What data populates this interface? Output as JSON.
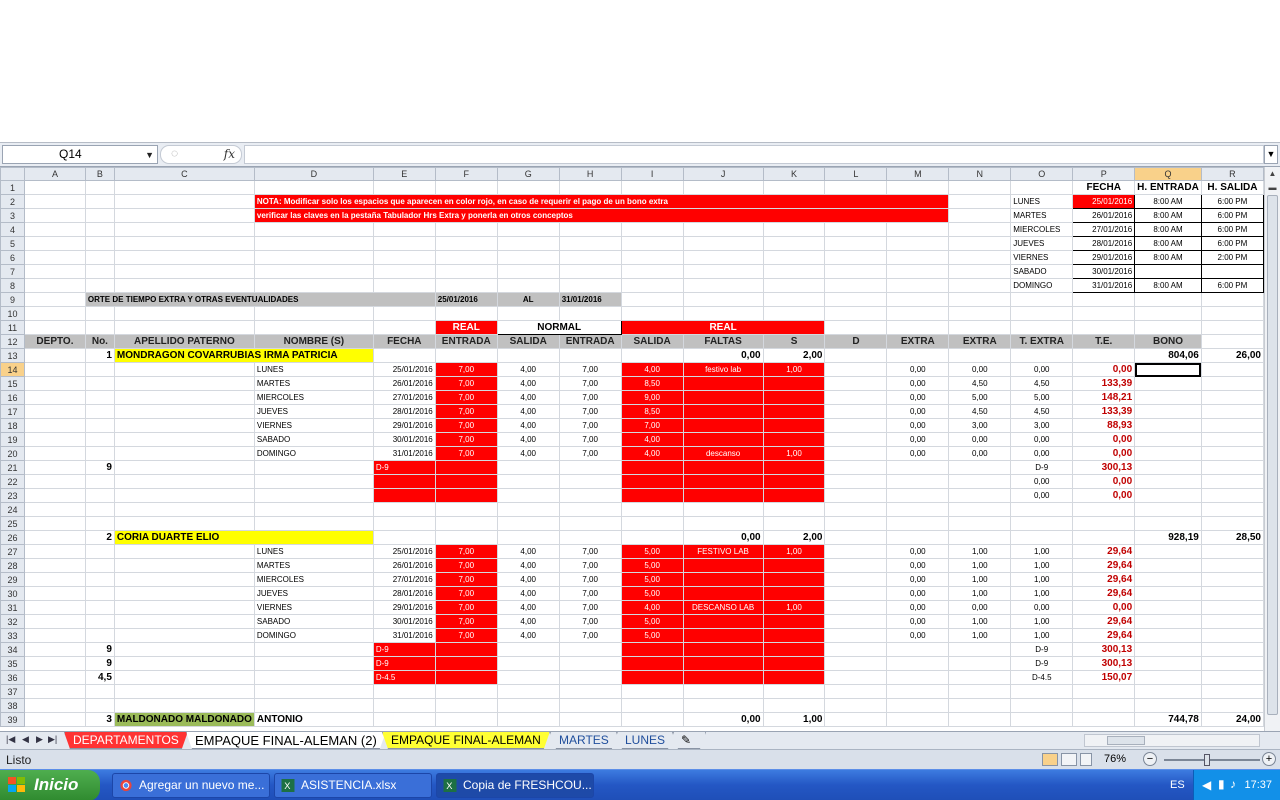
{
  "formula_bar": {
    "name_box": "Q14",
    "fx": "fx",
    "formula": ""
  },
  "columns": [
    "A",
    "B",
    "C",
    "D",
    "E",
    "F",
    "G",
    "H",
    "I",
    "J",
    "K",
    "L",
    "M",
    "N",
    "O",
    "P",
    "Q",
    "R"
  ],
  "selected_column": "Q",
  "selected_row": "14",
  "note": {
    "line1": "NOTA: Modificar solo los espacios que aparecen en color rojo, en caso de requerir el pago de un bono extra",
    "line2": "verificar las claves en la pestaña Tabulador Hrs Extra y ponerla en otros conceptos"
  },
  "schedule": {
    "headers": [
      "FECHA",
      "H. ENTRADA",
      "H. SALIDA"
    ],
    "rows": [
      {
        "day": "LUNES",
        "date": "25/01/2016",
        "in": "8:00 AM",
        "out": "6:00 PM"
      },
      {
        "day": "MARTES",
        "date": "26/01/2016",
        "in": "8:00 AM",
        "out": "6:00 PM"
      },
      {
        "day": "MIERCOLES",
        "date": "27/01/2016",
        "in": "8:00 AM",
        "out": "6:00 PM"
      },
      {
        "day": "JUEVES",
        "date": "28/01/2016",
        "in": "8:00 AM",
        "out": "6:00 PM"
      },
      {
        "day": "VIERNES",
        "date": "29/01/2016",
        "in": "8:00 AM",
        "out": "2:00 PM"
      },
      {
        "day": "SABADO",
        "date": "30/01/2016",
        "in": "",
        "out": ""
      },
      {
        "day": "DOMINGO",
        "date": "31/01/2016",
        "in": "8:00 AM",
        "out": "6:00 PM"
      }
    ]
  },
  "report": {
    "label": "ORTE DE TIEMPO EXTRA Y OTRAS EVENTUALIDADES",
    "from": "25/01/2016",
    "al": "AL",
    "to": "31/01/2016"
  },
  "group_headers": {
    "real1": "REAL",
    "normal": "NORMAL",
    "real2": "REAL"
  },
  "headers": [
    "DEPTO.",
    "No.",
    "APELLIDO PATERNO",
    "NOMBRE (S)",
    "FECHA",
    "ENTRADA",
    "SALIDA",
    "ENTRADA",
    "SALIDA",
    "FALTAS",
    "S",
    "D",
    "EXTRA",
    "EXTRA",
    "T. EXTRA",
    "T.E.",
    "BONO"
  ],
  "emp1": {
    "no": "1",
    "name": "MONDRAGON COVARRUBIAS IRMA PATRICIA",
    "j": "0,00",
    "k": "2,00",
    "q": "804,06",
    "r": "26,00",
    "days": [
      {
        "d": "LUNES",
        "e": "25/01/2016",
        "f": "7,00",
        "g": "4,00",
        "h": "7,00",
        "i": "4,00",
        "j": "festivo lab",
        "k": "1,00",
        "m": "0,00",
        "n": "0,00",
        "o": "0,00",
        "p": "0,00"
      },
      {
        "d": "MARTES",
        "e": "26/01/2016",
        "f": "7,00",
        "g": "4,00",
        "h": "7,00",
        "i": "8,50",
        "j": "",
        "k": "",
        "m": "0,00",
        "n": "4,50",
        "o": "4,50",
        "p": "133,39"
      },
      {
        "d": "MIERCOLES",
        "e": "27/01/2016",
        "f": "7,00",
        "g": "4,00",
        "h": "7,00",
        "i": "9,00",
        "j": "",
        "k": "",
        "m": "0,00",
        "n": "5,00",
        "o": "5,00",
        "p": "148,21"
      },
      {
        "d": "JUEVES",
        "e": "28/01/2016",
        "f": "7,00",
        "g": "4,00",
        "h": "7,00",
        "i": "8,50",
        "j": "",
        "k": "",
        "m": "0,00",
        "n": "4,50",
        "o": "4,50",
        "p": "133,39"
      },
      {
        "d": "VIERNES",
        "e": "29/01/2016",
        "f": "7,00",
        "g": "4,00",
        "h": "7,00",
        "i": "7,00",
        "j": "",
        "k": "",
        "m": "0,00",
        "n": "3,00",
        "o": "3,00",
        "p": "88,93"
      },
      {
        "d": "SABADO",
        "e": "30/01/2016",
        "f": "7,00",
        "g": "4,00",
        "h": "7,00",
        "i": "4,00",
        "j": "",
        "k": "",
        "m": "0,00",
        "n": "0,00",
        "o": "0,00",
        "p": "0,00"
      },
      {
        "d": "DOMINGO",
        "e": "31/01/2016",
        "f": "7,00",
        "g": "4,00",
        "h": "7,00",
        "i": "4,00",
        "j": "descanso",
        "k": "1,00",
        "m": "0,00",
        "n": "0,00",
        "o": "0,00",
        "p": "0,00"
      }
    ],
    "extra": [
      {
        "b": "9",
        "e": "D-9",
        "o": "D-9",
        "p": "300,13"
      },
      {
        "b": "",
        "e": "",
        "o": "0,00",
        "p": "0,00"
      },
      {
        "b": "",
        "e": "",
        "o": "0,00",
        "p": "0,00"
      }
    ]
  },
  "emp2": {
    "no": "2",
    "name": "CORIA DUARTE ELIO",
    "j": "0,00",
    "k": "2,00",
    "q": "928,19",
    "r": "28,50",
    "days": [
      {
        "d": "LUNES",
        "e": "25/01/2016",
        "f": "7,00",
        "g": "4,00",
        "h": "7,00",
        "i": "5,00",
        "j": "FESTIVO LAB",
        "k": "1,00",
        "m": "0,00",
        "n": "1,00",
        "o": "1,00",
        "p": "29,64"
      },
      {
        "d": "MARTES",
        "e": "26/01/2016",
        "f": "7,00",
        "g": "4,00",
        "h": "7,00",
        "i": "5,00",
        "j": "",
        "k": "",
        "m": "0,00",
        "n": "1,00",
        "o": "1,00",
        "p": "29,64"
      },
      {
        "d": "MIERCOLES",
        "e": "27/01/2016",
        "f": "7,00",
        "g": "4,00",
        "h": "7,00",
        "i": "5,00",
        "j": "",
        "k": "",
        "m": "0,00",
        "n": "1,00",
        "o": "1,00",
        "p": "29,64"
      },
      {
        "d": "JUEVES",
        "e": "28/01/2016",
        "f": "7,00",
        "g": "4,00",
        "h": "7,00",
        "i": "5,00",
        "j": "",
        "k": "",
        "m": "0,00",
        "n": "1,00",
        "o": "1,00",
        "p": "29,64"
      },
      {
        "d": "VIERNES",
        "e": "29/01/2016",
        "f": "7,00",
        "g": "4,00",
        "h": "7,00",
        "i": "4,00",
        "j": "DESCANSO LAB",
        "k": "1,00",
        "m": "0,00",
        "n": "0,00",
        "o": "0,00",
        "p": "0,00"
      },
      {
        "d": "SABADO",
        "e": "30/01/2016",
        "f": "7,00",
        "g": "4,00",
        "h": "7,00",
        "i": "5,00",
        "j": "",
        "k": "",
        "m": "0,00",
        "n": "1,00",
        "o": "1,00",
        "p": "29,64"
      },
      {
        "d": "DOMINGO",
        "e": "31/01/2016",
        "f": "7,00",
        "g": "4,00",
        "h": "7,00",
        "i": "5,00",
        "j": "",
        "k": "",
        "m": "0,00",
        "n": "1,00",
        "o": "1,00",
        "p": "29,64"
      }
    ],
    "extra": [
      {
        "b": "9",
        "e": "D-9",
        "o": "D-9",
        "p": "300,13"
      },
      {
        "b": "9",
        "e": "D-9",
        "o": "D-9",
        "p": "300,13"
      },
      {
        "b": "4,5",
        "e": "D-4.5",
        "o": "D-4.5",
        "p": "150,07"
      }
    ]
  },
  "emp3": {
    "no": "3",
    "surname": "MALDONADO MALDONADO",
    "first": "ANTONIO",
    "j": "0,00",
    "k": "1,00",
    "q": "744,78",
    "r": "24,00"
  },
  "sheet_tabs": [
    "DEPARTAMENTOS",
    "EMPAQUE FINAL-ALEMAN (2)",
    "EMPAQUE FINAL-ALEMAN",
    "MARTES",
    "LUNES"
  ],
  "status": {
    "text": "Listo",
    "zoom": "76%",
    "zoom_level": 0.45
  },
  "taskbar": {
    "start": "Inicio",
    "tasks": [
      "Agregar un nuevo me...",
      "ASISTENCIA.xlsx",
      "Copia de FRESHCOU..."
    ],
    "lang": "ES",
    "clock": "17:37"
  },
  "colors": {
    "red": "#ff0000",
    "yellow": "#ffff00",
    "green": "#9bbb59",
    "gray": "#c0c0c0",
    "selection": "#f9d18a"
  }
}
